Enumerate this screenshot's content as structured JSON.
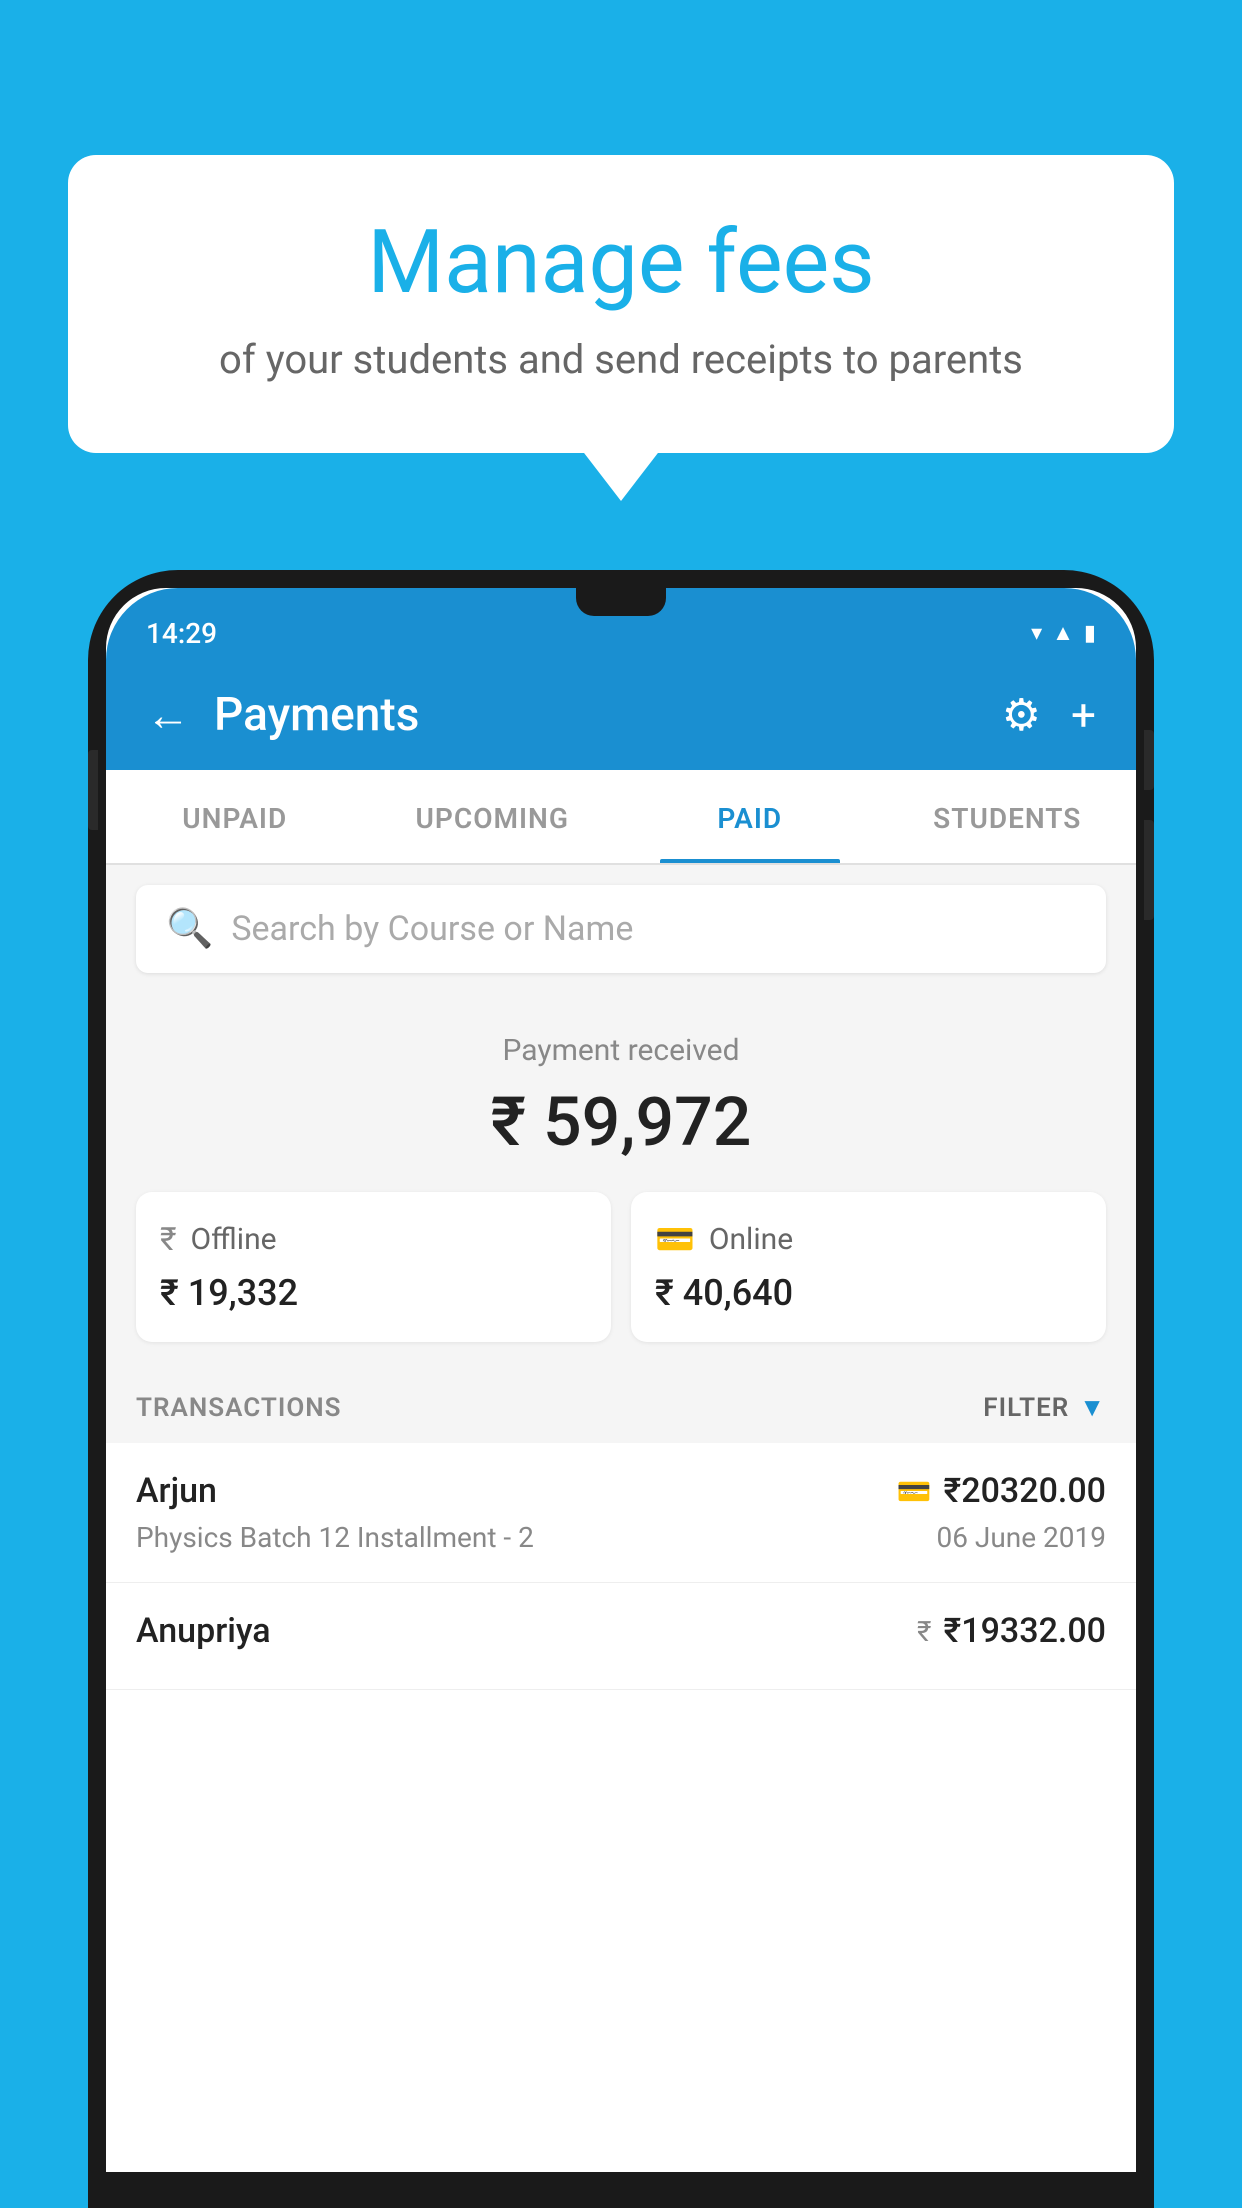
{
  "background_color": "#1ab0e8",
  "speech_bubble": {
    "title": "Manage fees",
    "subtitle": "of your students and send receipts to parents"
  },
  "phone": {
    "status_bar": {
      "time": "14:29",
      "icons": [
        "wifi",
        "signal",
        "battery"
      ]
    },
    "header": {
      "title": "Payments",
      "back_label": "←",
      "settings_icon": "gear",
      "add_icon": "+"
    },
    "tabs": [
      {
        "label": "UNPAID",
        "active": false
      },
      {
        "label": "UPCOMING",
        "active": false
      },
      {
        "label": "PAID",
        "active": true
      },
      {
        "label": "STUDENTS",
        "active": false
      }
    ],
    "search": {
      "placeholder": "Search by Course or Name"
    },
    "payment_summary": {
      "label": "Payment received",
      "total": "₹ 59,972",
      "offline": {
        "type": "Offline",
        "amount": "₹ 19,332"
      },
      "online": {
        "type": "Online",
        "amount": "₹ 40,640"
      }
    },
    "transactions": {
      "header_label": "TRANSACTIONS",
      "filter_label": "FILTER",
      "items": [
        {
          "name": "Arjun",
          "course": "Physics Batch 12 Installment - 2",
          "amount": "₹20320.00",
          "date": "06 June 2019",
          "payment_type": "card"
        },
        {
          "name": "Anupriya",
          "course": "",
          "amount": "₹19332.00",
          "date": "",
          "payment_type": "cash"
        }
      ]
    }
  }
}
